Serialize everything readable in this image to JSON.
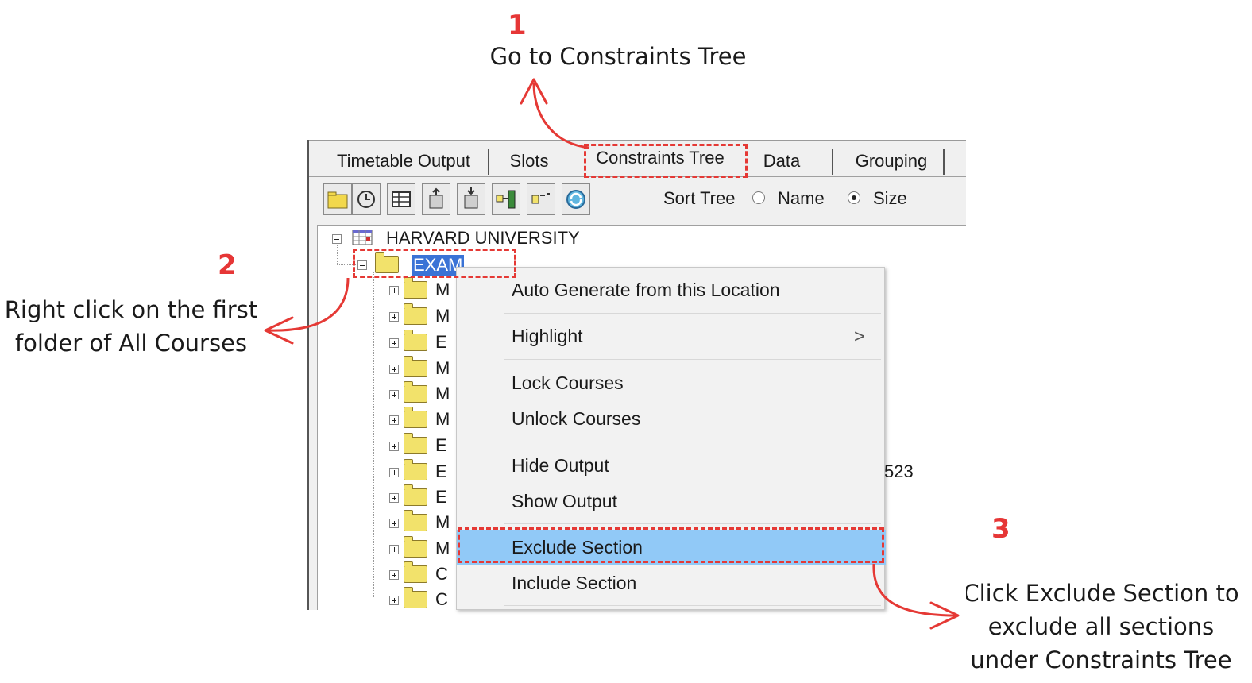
{
  "annotations": {
    "step1": {
      "number": "1",
      "text": "Go to Constraints Tree"
    },
    "step2": {
      "number": "2",
      "text_line1": "Right click on the first",
      "text_line2": "folder of All Courses"
    },
    "step3": {
      "number": "3",
      "text_line1": "Click Exclude Section to",
      "text_line2": "exclude all sections",
      "text_line3": "under Constraints Tree"
    },
    "accent_color": "#e53935"
  },
  "tabs": [
    {
      "label": "Timetable Output"
    },
    {
      "label": "Slots"
    },
    {
      "label": "Constraints Tree",
      "active": true
    },
    {
      "label": "Data"
    },
    {
      "label": "Grouping"
    }
  ],
  "toolbar": {
    "icons": [
      "folder-icon",
      "history-icon",
      "grid-icon",
      "export-icon",
      "import-icon",
      "tree-link-icon",
      "node-icon",
      "refresh-icon"
    ],
    "sort_label": "Sort Tree",
    "sort_options": [
      {
        "label": "Name",
        "selected": false
      },
      {
        "label": "Size",
        "selected": true
      }
    ]
  },
  "tree": {
    "root": "HARVARD UNIVERSITY",
    "first_folder": "EXAM",
    "child_initials": [
      "M",
      "M",
      "E",
      "M",
      "M",
      "M",
      "E",
      "E",
      "E",
      "M",
      "M",
      "C",
      "C"
    ],
    "partial_text": "523"
  },
  "context_menu": {
    "items": [
      {
        "label": "Auto Generate from this Location"
      },
      {
        "label": "Highlight",
        "has_submenu": true,
        "submenu_glyph": ">"
      },
      {
        "label": "Lock Courses"
      },
      {
        "label": "Unlock Courses"
      },
      {
        "label": "Hide Output"
      },
      {
        "label": "Show Output"
      },
      {
        "label": "Exclude Section",
        "highlighted": true
      },
      {
        "label": "Include Section"
      }
    ],
    "highlight_color": "#91c9f7"
  }
}
